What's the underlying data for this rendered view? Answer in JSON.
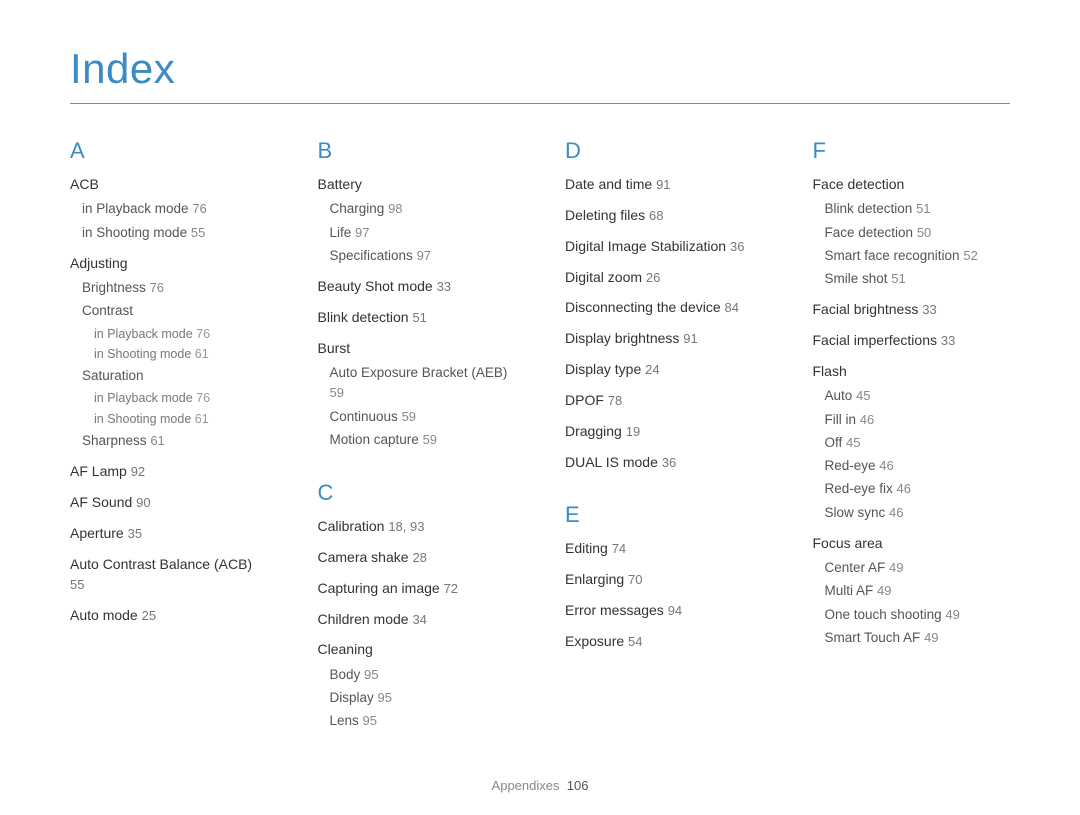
{
  "title": "Index",
  "footer": {
    "section": "Appendixes",
    "page": "106"
  },
  "columns": [
    {
      "sections": [
        {
          "letter": "A",
          "items": [
            {
              "label": "ACB",
              "children": [
                {
                  "label": "in Playback mode",
                  "page": "76"
                },
                {
                  "label": "in Shooting mode",
                  "page": "55"
                }
              ]
            },
            {
              "label": "Adjusting",
              "children": [
                {
                  "label": "Brightness",
                  "page": "76"
                },
                {
                  "label": "Contrast",
                  "children": [
                    {
                      "label": "in Playback mode",
                      "page": "76"
                    },
                    {
                      "label": "in Shooting mode",
                      "page": "61"
                    }
                  ]
                },
                {
                  "label": "Saturation",
                  "children": [
                    {
                      "label": "in Playback mode",
                      "page": "76"
                    },
                    {
                      "label": "in Shooting mode",
                      "page": "61"
                    }
                  ]
                },
                {
                  "label": "Sharpness",
                  "page": "61"
                }
              ]
            },
            {
              "label": "AF Lamp",
              "page": "92"
            },
            {
              "label": "AF Sound",
              "page": "90"
            },
            {
              "label": "Aperture",
              "page": "35"
            },
            {
              "label": "Auto Contrast Balance (ACB)",
              "page": "55"
            },
            {
              "label": "Auto mode",
              "page": "25"
            }
          ]
        }
      ]
    },
    {
      "sections": [
        {
          "letter": "B",
          "items": [
            {
              "label": "Battery",
              "children": [
                {
                  "label": "Charging",
                  "page": "98"
                },
                {
                  "label": "Life",
                  "page": "97"
                },
                {
                  "label": "Specifications",
                  "page": "97"
                }
              ]
            },
            {
              "label": "Beauty Shot mode",
              "page": "33"
            },
            {
              "label": "Blink detection",
              "page": "51"
            },
            {
              "label": "Burst",
              "children": [
                {
                  "label": "Auto Exposure Bracket (AEB)",
                  "page": "59"
                },
                {
                  "label": "Continuous",
                  "page": "59"
                },
                {
                  "label": "Motion capture",
                  "page": "59"
                }
              ]
            }
          ]
        },
        {
          "letter": "C",
          "items": [
            {
              "label": "Calibration",
              "page": "18, 93"
            },
            {
              "label": "Camera shake",
              "page": "28"
            },
            {
              "label": "Capturing an image",
              "page": "72"
            },
            {
              "label": "Children mode",
              "page": "34"
            },
            {
              "label": "Cleaning",
              "children": [
                {
                  "label": "Body",
                  "page": "95"
                },
                {
                  "label": "Display",
                  "page": "95"
                },
                {
                  "label": "Lens",
                  "page": "95"
                }
              ]
            }
          ]
        }
      ]
    },
    {
      "sections": [
        {
          "letter": "D",
          "items": [
            {
              "label": "Date and time",
              "page": "91"
            },
            {
              "label": "Deleting files",
              "page": "68"
            },
            {
              "label": "Digital Image Stabilization",
              "page": "36"
            },
            {
              "label": "Digital zoom",
              "page": "26"
            },
            {
              "label": "Disconnecting the device",
              "page": "84"
            },
            {
              "label": "Display brightness",
              "page": "91"
            },
            {
              "label": "Display type",
              "page": "24"
            },
            {
              "label": "DPOF",
              "page": "78"
            },
            {
              "label": "Dragging",
              "page": "19"
            },
            {
              "label": "DUAL IS mode",
              "page": "36"
            }
          ]
        },
        {
          "letter": "E",
          "items": [
            {
              "label": "Editing",
              "page": "74"
            },
            {
              "label": "Enlarging",
              "page": "70"
            },
            {
              "label": "Error messages",
              "page": "94"
            },
            {
              "label": "Exposure",
              "page": "54"
            }
          ]
        }
      ]
    },
    {
      "sections": [
        {
          "letter": "F",
          "items": [
            {
              "label": "Face detection",
              "children": [
                {
                  "label": "Blink detection",
                  "page": "51"
                },
                {
                  "label": "Face detection",
                  "page": "50"
                },
                {
                  "label": "Smart face recognition",
                  "page": "52"
                },
                {
                  "label": "Smile shot",
                  "page": "51"
                }
              ]
            },
            {
              "label": "Facial brightness",
              "page": "33"
            },
            {
              "label": "Facial imperfections",
              "page": "33"
            },
            {
              "label": "Flash",
              "children": [
                {
                  "label": "Auto",
                  "page": "45"
                },
                {
                  "label": "Fill in",
                  "page": "46"
                },
                {
                  "label": "Off",
                  "page": "45"
                },
                {
                  "label": "Red-eye",
                  "page": "46"
                },
                {
                  "label": "Red-eye fix",
                  "page": "46"
                },
                {
                  "label": "Slow sync",
                  "page": "46"
                }
              ]
            },
            {
              "label": "Focus area",
              "children": [
                {
                  "label": "Center AF",
                  "page": "49"
                },
                {
                  "label": "Multi AF",
                  "page": "49"
                },
                {
                  "label": "One touch shooting",
                  "page": "49"
                },
                {
                  "label": "Smart Touch AF",
                  "page": "49"
                }
              ]
            }
          ]
        }
      ]
    }
  ]
}
